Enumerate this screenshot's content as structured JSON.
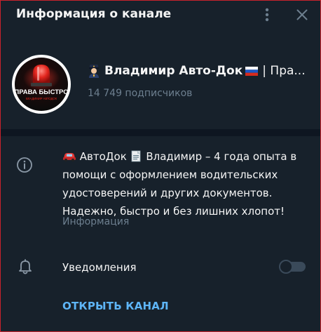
{
  "header": {
    "title": "Информация о канале",
    "menu_icon": "vertical-dots-icon",
    "close_icon": "close-icon"
  },
  "profile": {
    "avatar_text": "ПРАВА БЫСТРО",
    "avatar_subtext": "ВЛАДИМИР АВТОДОК",
    "name_prefix_icon": "police-officer-emoji",
    "name_main": "Владимир Авто-Док",
    "name_flag_icon": "russia-flag-emoji",
    "name_rest": "| Пра...",
    "subscribers": "14 749 подписчиков"
  },
  "info": {
    "icon": "info-icon",
    "desc_line1_text1": "АвтоДок",
    "desc_line1_text2": "Владимир – 4 года опыта в",
    "desc_line2": "помощи с оформлением водительских",
    "desc_line3": "удостоверений и других документов.",
    "desc_line4": "Надежно, быстро и без лишних хлопот!",
    "car_icon": "red-car-emoji",
    "doc_icon": "document-emoji",
    "label": "Информация"
  },
  "notifications": {
    "icon": "bell-icon",
    "label": "Уведомления",
    "enabled": false
  },
  "actions": {
    "open_channel": "ОТКРЫТЬ КАНАЛ"
  },
  "colors": {
    "background": "#17212b",
    "separator": "#0e1621",
    "muted_text": "#6d7f8f",
    "accent": "#5eb5f7",
    "border": "#c8232c"
  }
}
